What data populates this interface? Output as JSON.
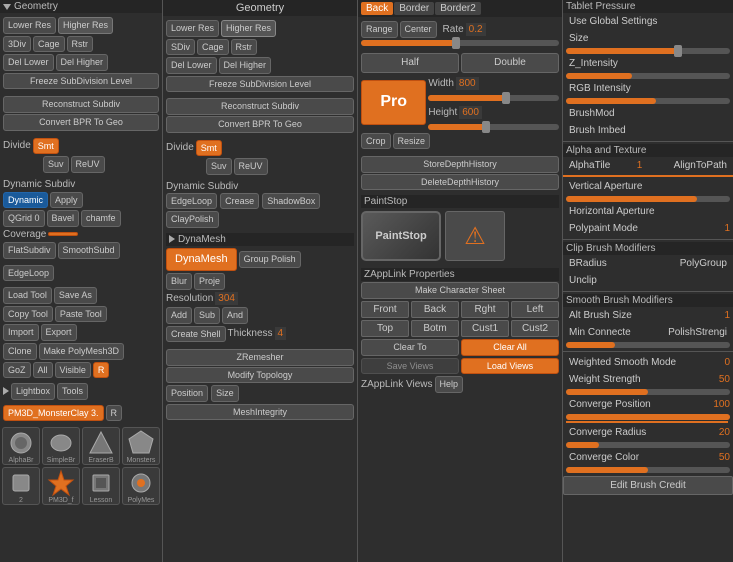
{
  "col1": {
    "geometry_label": "Geometry",
    "subdiv_buttons": {
      "lower_res": "Lower Res",
      "higher_res": "Higher Res",
      "sdiv": "3Div",
      "cage": "Cage",
      "rstr": "Rstr",
      "del_lower": "Del Lower",
      "del_higher": "Del Higher",
      "freeze": "Freeze SubDivision Level"
    },
    "reconstruct": "Reconstruct Subdiv",
    "convert_bpr": "Convert BPR To Geo",
    "divide_label": "Divide",
    "smt_label": "Smt",
    "suv_label": "Suv",
    "reuv_label": "ReUV",
    "dynamic_subdiv": "Dynamic Subdiv",
    "dynamic_btn": "Dynamic",
    "apply_btn": "Apply",
    "qgrid": "QGrid 0",
    "bevel": "Bavel",
    "chamfe": "chamfe",
    "coverage_label": "Coverage",
    "flat_subdiv": "FlatSubdiv",
    "smooth_subd": "SmoothSubd",
    "edge_loop": "EdgeLoop",
    "load_tool": "Load Tool",
    "save_as": "Save As",
    "copy_tool": "Copy Tool",
    "paste_tool": "Paste Tool",
    "import": "Import",
    "export": "Export",
    "clone": "Clone",
    "make_poly3d": "Make PolyMesh3D",
    "goz": "GoZ",
    "all": "All",
    "visible": "Visible",
    "r_btn": "R",
    "lightbox": "Lightbox",
    "tools": "Tools",
    "pm3d_monster": "PM3D_MonsterClay 3.",
    "r_mini": "R"
  },
  "col2": {
    "geometry_label": "Geometry",
    "lower_res": "Lower Res",
    "higher_res": "Higher Res",
    "sdiv": "SDiv",
    "cage": "Cage",
    "rstr": "Rstr",
    "del_lower": "Del Lower",
    "del_higher": "Del Higher",
    "freeze": "Freeze SubDivision Level",
    "reconstruct": "Reconstruct Subdiv",
    "convert_bpr": "Convert BPR To Geo",
    "divide_label": "Divide",
    "smt_label": "Smt",
    "suv_label": "Suv",
    "reuv_label": "ReUV",
    "dynamic_subdiv": "Dynamic Subdiv",
    "edge_loop": "EdgeLoop",
    "crease": "Crease",
    "shadow_box": "ShadowBox",
    "clay_polish": "ClayPolish",
    "dyna_mesh": "DynaMesh",
    "dyna_mesh_btn": "DynaMesh",
    "group_polish": "Group Polish",
    "blur": "Blur",
    "proje": "Proje",
    "resolution": "Resolution",
    "resolution_val": "304",
    "add": "Add",
    "sub": "Sub",
    "and": "And",
    "create_shell": "Create Shell",
    "thickness": "Thickness",
    "thickness_val": "4",
    "zremesher": "ZRemesher",
    "modify_topology": "Modify Topology",
    "position": "Position",
    "size": "Size",
    "mesh_integrity": "MeshIntegrity"
  },
  "col3": {
    "back_label": "Back",
    "border_label": "Border",
    "border2_label": "Border2",
    "range_label": "Range",
    "center_label": "Center",
    "rate_label": "Rate",
    "rate_val": "0.2",
    "half_label": "Half",
    "double_label": "Double",
    "width_label": "Width",
    "width_val": "800",
    "height_label": "Height",
    "height_val": "600",
    "crop_label": "Crop",
    "resize_label": "Resize",
    "pro_label": "Pro",
    "store_depth": "StoreDepthHistory",
    "delete_depth": "DeleteDepthHistory",
    "paint_stop_section": "PaintStop",
    "paint_stop_btn": "PaintStop",
    "zapplink_header": "ZAppLink Properties",
    "make_char_sheet": "Make Character Sheet",
    "front": "Front",
    "back": "Back",
    "rght": "Rght",
    "left": "Left",
    "top": "Top",
    "botm": "Botm",
    "cust1": "Cust1",
    "cust2": "Cust2",
    "clear_to": "Clear To",
    "clear_all": "Clear All",
    "save_views": "Save Views",
    "load_views": "Load Views",
    "zapplink_views": "ZAppLink Views",
    "help": "Help"
  },
  "col4": {
    "tablet_pressure": "Tablet Pressure",
    "use_global": "Use Global Settings",
    "size_label": "Size",
    "z_intensity": "Z_Intensity",
    "rgb_intensity": "RGB Intensity",
    "brush_mod": "BrushMod",
    "brush_imbed": "Brush Imbed",
    "alpha_texture": "Alpha and Texture",
    "alpha_tile": "AlphaTile",
    "alpha_tile_val": "1",
    "align_to_path": "AlignToPath",
    "vertical_aperture": "Vertical Aperture",
    "horizontal_aperture": "Horizontal Aperture",
    "polypaint_mode": "Polypaint Mode",
    "polypaint_val": "1",
    "clip_brush": "Clip Brush Modifiers",
    "bradius": "BRadius",
    "polygroup": "PolyGroup",
    "unclip": "Unclip",
    "smooth_brush": "Smooth Brush Modifiers",
    "alt_brush_size": "Alt Brush Size",
    "alt_brush_val": "1",
    "min_connecte": "Min Connecte",
    "polish_strengi": "PolishStrengi",
    "weighted_smooth": "Weighted Smooth Mode",
    "weighted_val": "0",
    "weight_strength": "Weight Strength",
    "weight_val": "50",
    "converge_position": "Converge Position",
    "converge_pos_val": "100",
    "converge_radius": "Converge Radius",
    "converge_rad_val": "20",
    "converge_color": "Converge Color",
    "converge_col_val": "50",
    "edit_brush_credit": "Edit Brush Credit"
  },
  "tools": [
    {
      "name": "PM3D_f AlphaBr",
      "icon": "circle"
    },
    {
      "name": "SimpleBr EraserB",
      "icon": "diamond"
    },
    {
      "name": "PM3D_Monsters 2",
      "icon": "star"
    },
    {
      "name": "PM3D_f Lesson_",
      "icon": "triangle"
    },
    {
      "name": "PM3D_f PolyMes",
      "icon": "square"
    },
    {
      "name": "PM3D_f PM3D_",
      "icon": "pentagon"
    }
  ],
  "colors": {
    "orange": "#e07020",
    "dark_bg": "#2e2e2e",
    "med_bg": "#3a3a3a",
    "light_bg": "#4a4a4a",
    "border": "#555555",
    "text": "#cccccc",
    "orange_text": "#e07020"
  }
}
